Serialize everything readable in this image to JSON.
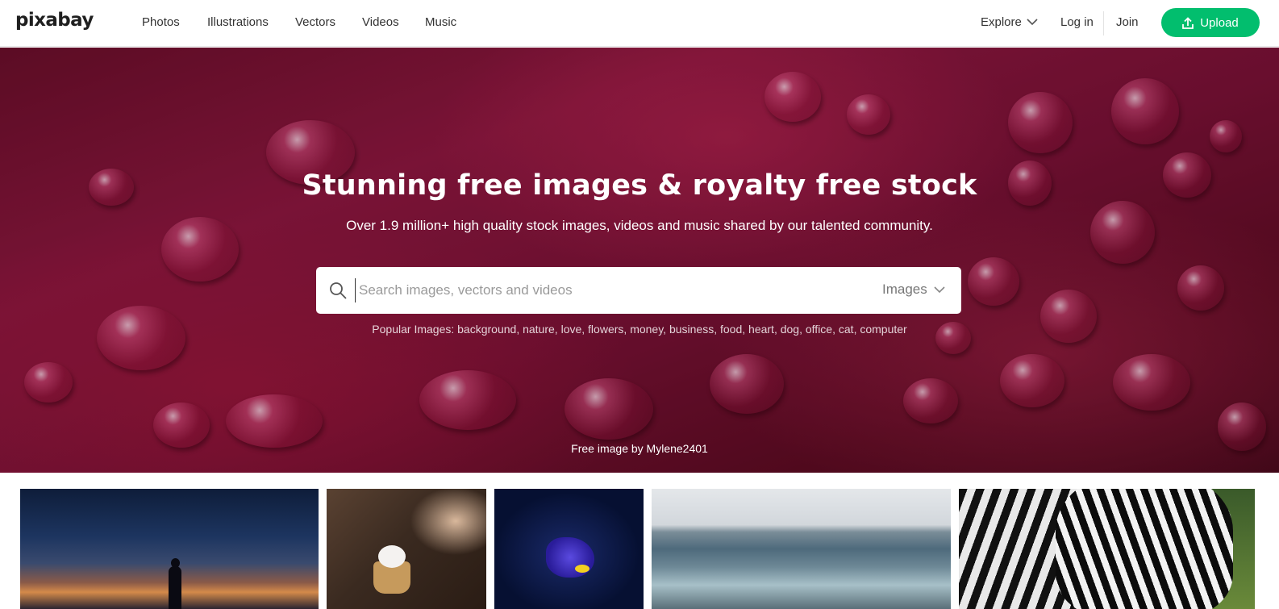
{
  "header": {
    "logo": "pixabay",
    "nav": [
      "Photos",
      "Illustrations",
      "Vectors",
      "Videos",
      "Music"
    ],
    "explore": "Explore",
    "login": "Log in",
    "join": "Join",
    "upload": "Upload"
  },
  "hero": {
    "title": "Stunning free images & royalty free stock",
    "subtitle": "Over 1.9 million+ high quality stock images, videos and music shared by our talented community.",
    "search_placeholder": "Search images, vectors and videos",
    "search_type": "Images",
    "popular_label": "Popular Images:",
    "popular_tags": [
      "background",
      "nature",
      "love",
      "flowers",
      "money",
      "business",
      "food",
      "heart",
      "dog",
      "office",
      "cat",
      "computer"
    ],
    "credit": "Free image by Mylene2401"
  },
  "colors": {
    "accent": "#02be6e",
    "hero_base": "#7a1236"
  },
  "icons": {
    "search": "search-icon",
    "upload": "upload-icon",
    "explore_chevron": "chevron-down-icon",
    "type_chevron": "chevron-down-icon"
  }
}
